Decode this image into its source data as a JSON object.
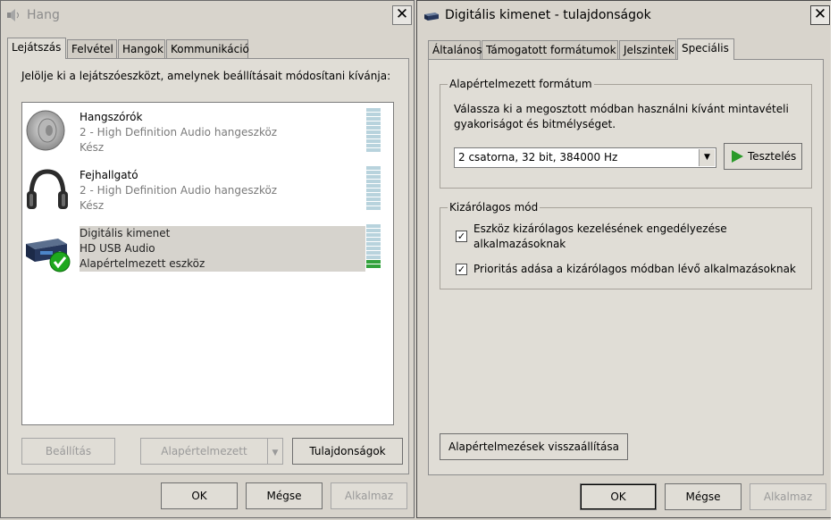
{
  "hang_window": {
    "title": "Hang",
    "close_glyph": "✕",
    "tabs": [
      {
        "label": "Lejátszás",
        "active": true
      },
      {
        "label": "Felvétel",
        "active": false
      },
      {
        "label": "Hangok",
        "active": false
      },
      {
        "label": "Kommunikáció",
        "active": false
      }
    ],
    "instruction": "Jelölje ki a lejátszóeszközt, amelynek beállításait módosítani kívánja:",
    "devices": [
      {
        "name": "Hangszórók",
        "line2": "2 - High Definition Audio hangeszköz",
        "status": "Kész",
        "icon": "speaker-icon",
        "meter_level": 0
      },
      {
        "name": "Fejhallgató",
        "line2": "2 - High Definition Audio hangeszköz",
        "status": "Kész",
        "icon": "headphones-icon",
        "meter_level": 0
      },
      {
        "name": "Digitális kimenet",
        "line2": "HD USB Audio",
        "status": "Alapértelmezett eszköz",
        "icon": "digital-output-icon",
        "meter_level": 0.2,
        "default_check": true
      }
    ],
    "buttons": {
      "configure": "Beállítás",
      "set_default": "Alapértelmezett",
      "properties": "Tulajdonságok",
      "ok": "OK",
      "cancel": "Mégse",
      "apply": "Alkalmaz"
    }
  },
  "props_window": {
    "title": "Digitális kimenet - tulajdonságok",
    "close_glyph": "✕",
    "tabs": [
      {
        "label": "Általános",
        "active": false
      },
      {
        "label": "Támogatott formátumok",
        "active": false
      },
      {
        "label": "Jelszintek",
        "active": false
      },
      {
        "label": "Speciális",
        "active": true
      }
    ],
    "default_format": {
      "group_title": "Alapértelmezett formátum",
      "description_line1": "Válassza ki a megosztott módban használni kívánt mintavételi",
      "description_line2": "gyakoriságot és bitmélységet.",
      "selected_format": "2 csatorna, 32 bit, 384000 Hz",
      "test_button": "Tesztelés"
    },
    "exclusive_mode": {
      "group_title": "Kizárólagos mód",
      "option1_line1": "Eszköz kizárólagos kezelésének engedélyezése",
      "option1_line2": "alkalmazásoknak",
      "option1_checked": true,
      "option2": "Prioritás adása a kizárólagos módban lévő alkalmazásoknak",
      "option2_checked": true
    },
    "restore_defaults": "Alapértelmezések visszaállítása",
    "buttons": {
      "ok": "OK",
      "cancel": "Mégse",
      "apply": "Alkalmaz"
    }
  },
  "colors": {
    "play_green": "#2a9a2a",
    "check_green": "#1ea81e",
    "meter_active": "#32a23c"
  }
}
